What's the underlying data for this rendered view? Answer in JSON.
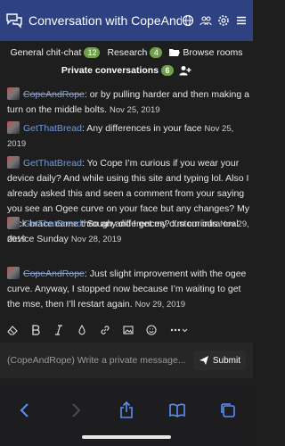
{
  "header": {
    "title": "Conversation with CopeAndRope",
    "icons": [
      "chat-bubbles-icon",
      "globe-icon",
      "users-icon",
      "gear-icon",
      "menu-icon"
    ]
  },
  "tabs": {
    "general": {
      "label": "General chit-chat",
      "count": "12"
    },
    "research": {
      "label": "Research",
      "count": "4"
    },
    "browse": {
      "label": "Browse rooms"
    },
    "private": {
      "label": "Private conversations",
      "count": "6"
    }
  },
  "messages": [
    {
      "user": "CopeAndRope",
      "struck": true,
      "text": ": or by pulling harder and then making a turn on the middle bolts.",
      "time": "Nov 25, 2019"
    },
    {
      "user": "GetThatBread",
      "struck": false,
      "text": ": Any differences in your face",
      "time": "Nov 25, 2019"
    },
    {
      "user": "GetThatBread",
      "struck": false,
      "text": ": Yo Cope I’m curious if you wear your device daily? And while using this site and typing lol. Also I already asked this and seen a comment from your saying you see an Ogee curve on your face but any changes? My neck brace came through and I get my custom infra oral device Sunday",
      "time": "Nov 28, 2019"
    },
    {
      "user": "GetThatBread",
      "struck": false,
      "text": ": So any differences? I’m curious",
      "time": "Nov 29, 2019"
    },
    {
      "user": "CopeAndRope",
      "struck": true,
      "text": ": Just slight improvement with the ogee curve. Anyway, I stopped now because I’m waiting to get the mse, then I’ll restart again.",
      "time": "Nov 29, 2019"
    }
  ],
  "toolbar": {
    "icons": [
      "eraser-icon",
      "bold-icon",
      "italic-icon",
      "color-drop-icon",
      "link-icon",
      "image-icon",
      "emoji-icon",
      "more-icon"
    ]
  },
  "composer": {
    "placeholder": "(CopeAndRope) Write a private message...",
    "submit_label": "Submit"
  },
  "browser_bar": {
    "icons": [
      "back-icon",
      "forward-icon",
      "share-icon",
      "bookmarks-icon",
      "tabs-icon"
    ]
  }
}
